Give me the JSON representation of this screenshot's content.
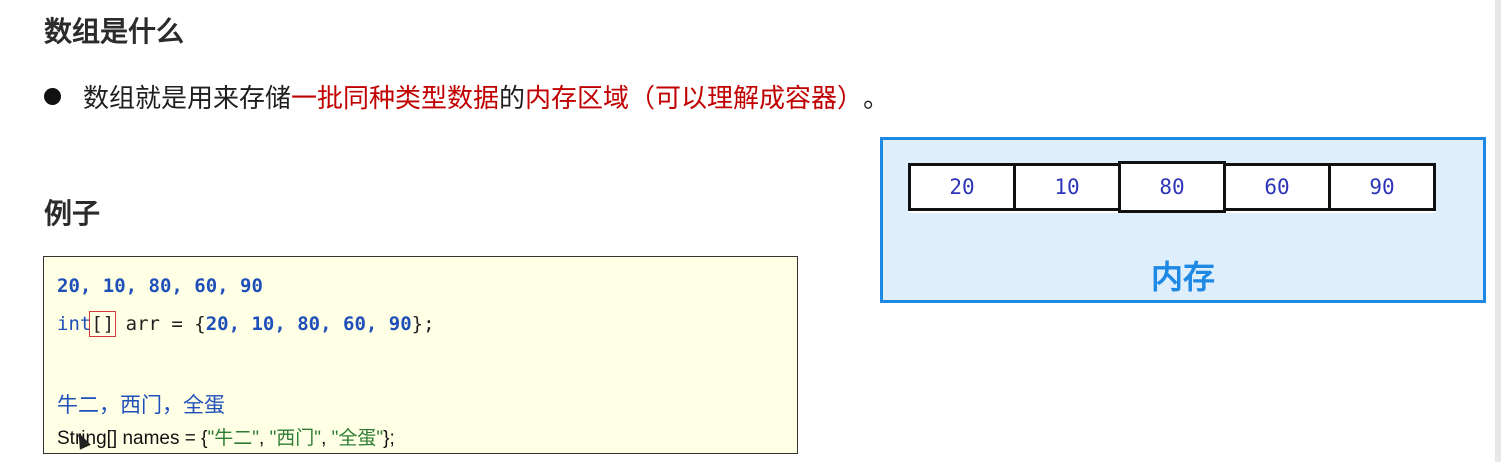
{
  "title": "数组是什么",
  "bullet": {
    "prefix": "数组就是用来存储",
    "highlight1": "一批同种类型数据",
    "middle": "的",
    "highlight2": "内存区域（可以理解成容器）",
    "suffix": "。"
  },
  "example_title": "例子",
  "code": {
    "line1": "20, 10, 80, 60, 90",
    "line2": {
      "keyword": "int",
      "brackets": "[]",
      "decl": " arr = {",
      "values": "20, 10, 80, 60, 90",
      "end": "};"
    },
    "line3": "牛二，西门，全蛋",
    "line4": {
      "type": "String[] names = {",
      "s1": "\"牛二\"",
      "sep1": ", ",
      "s2": "\"西门\"",
      "sep2": ", ",
      "s3": "\"全蛋\"",
      "end": "};"
    }
  },
  "memory": {
    "cells": [
      "20",
      "10",
      "80",
      "60",
      "90"
    ],
    "label": "内存"
  },
  "colors": {
    "highlight_red": "#c00000",
    "memory_blue": "#1e88e5",
    "code_bg": "#ffffe6"
  }
}
